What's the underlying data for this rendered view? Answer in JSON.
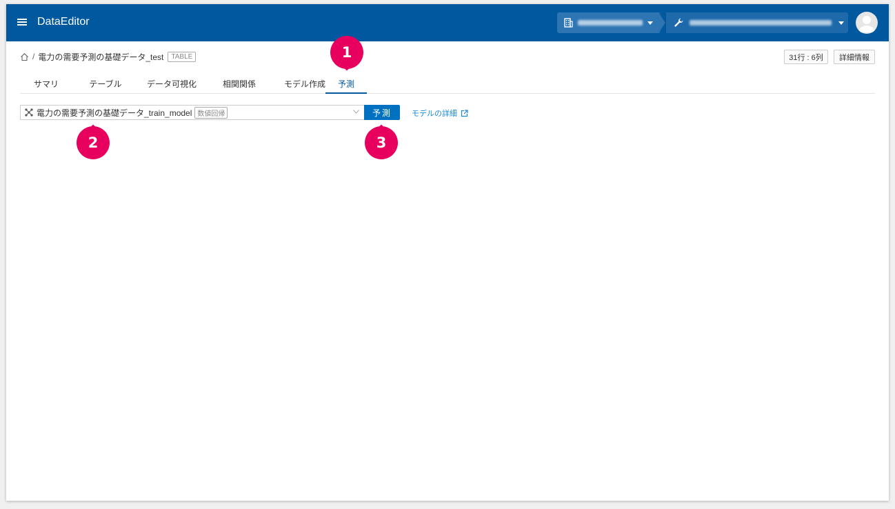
{
  "header": {
    "app_title": "DataEditor",
    "org_selector_label": "",
    "project_selector_label": ""
  },
  "breadcrumb": {
    "dataset_name": "電力の需要予測の基礎データ_test",
    "separator": "/",
    "type_badge": "TABLE"
  },
  "stats": {
    "rows_cols": "31行 : 6列",
    "details_button": "詳細情報"
  },
  "tabs": [
    {
      "label": "サマリ",
      "active": false
    },
    {
      "label": "テーブル",
      "active": false
    },
    {
      "label": "データ可視化",
      "active": false
    },
    {
      "label": "相関関係",
      "active": false
    },
    {
      "label": "モデル作成",
      "active": false
    },
    {
      "label": "予測",
      "active": true
    }
  ],
  "prediction": {
    "model_name": "電力の需要予測の基礎データ_train_model",
    "model_type_badge": "数値回帰",
    "predict_button": "予測",
    "model_details_link": "モデルの詳細"
  },
  "markers": [
    "1",
    "2",
    "3"
  ],
  "colors": {
    "header_bg": "#00589f",
    "accent": "#0070c0",
    "link": "#1a8ad8",
    "marker": "#e8005f"
  }
}
